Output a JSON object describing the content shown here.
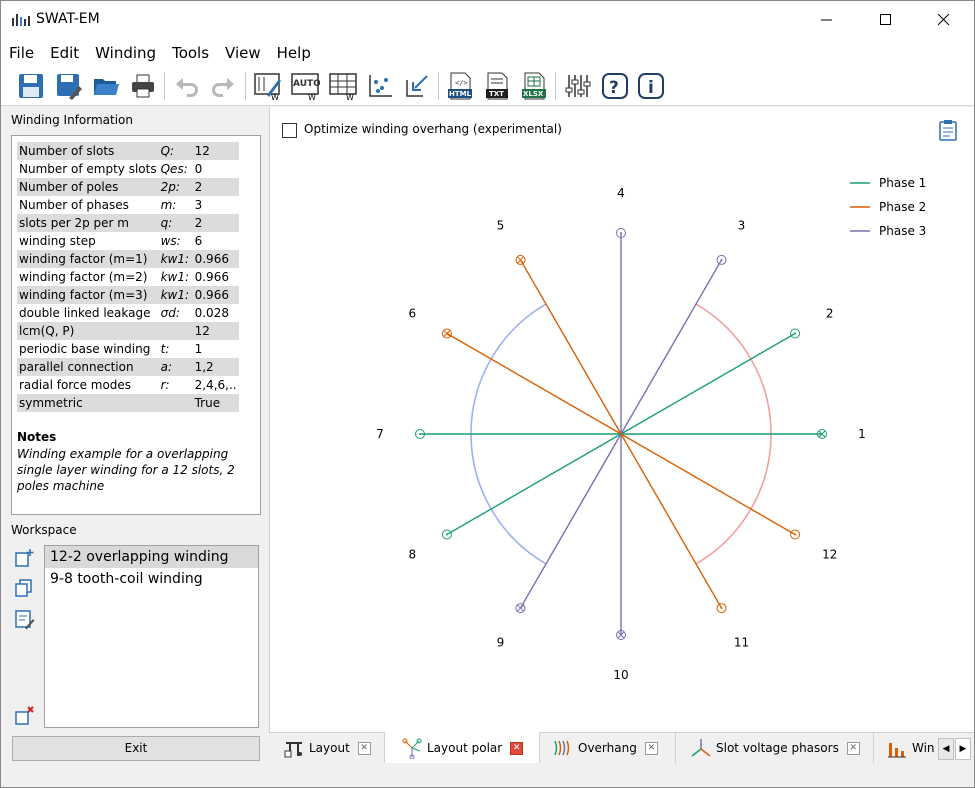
{
  "app": {
    "title": "SWAT-EM"
  },
  "menu": [
    "File",
    "Edit",
    "Winding",
    "Tools",
    "View",
    "Help"
  ],
  "toolbar": {
    "icons": [
      "save-icon",
      "save-as-icon",
      "open-folder-icon",
      "print-icon",
      "undo-icon",
      "redo-icon",
      "winding-editor-icon",
      "auto-winding-icon",
      "table-winding-icon",
      "scatter-plot-icon",
      "import-icon",
      "export-html-icon",
      "export-txt-icon",
      "export-xlsx-icon",
      "settings-sliders-icon",
      "help-icon",
      "info-icon"
    ],
    "labels": {
      "html": "HTML",
      "txt": "TXT",
      "xlsx": "XLSX",
      "auto": "AUTO"
    }
  },
  "winding_info": {
    "label": "Winding Information",
    "rows": [
      [
        "Number of slots",
        "Q:",
        "12"
      ],
      [
        "Number of empty slots",
        "Qes:",
        "0"
      ],
      [
        "Number of poles",
        "2p:",
        "2"
      ],
      [
        "Number of phases",
        "m:",
        "3"
      ],
      [
        "slots per 2p per m",
        "q:",
        "2"
      ],
      [
        "winding step",
        "ws:",
        "6"
      ],
      [
        "winding factor (m=1)",
        "kw1:",
        "0.966"
      ],
      [
        "winding factor (m=2)",
        "kw1:",
        "0.966"
      ],
      [
        "winding factor (m=3)",
        "kw1:",
        "0.966"
      ],
      [
        "double linked leakage",
        "σd:",
        "0.028"
      ],
      [
        "lcm(Q, P)",
        "",
        "12"
      ],
      [
        "periodic base winding",
        "t:",
        "1"
      ],
      [
        "parallel connection",
        "a:",
        "1,2"
      ],
      [
        "radial force modes",
        "r:",
        "2,4,6,.."
      ],
      [
        "symmetric",
        "",
        "True"
      ]
    ],
    "notes_title": "Notes",
    "notes_text": "Winding example for a overlapping single layer winding for a 12 slots, 2 poles machine"
  },
  "workspace": {
    "label": "Workspace",
    "items": [
      "12-2 overlapping winding",
      "9-8 tooth-coil winding"
    ],
    "selected": 0
  },
  "exit_label": "Exit",
  "plot": {
    "checkbox_label": "Optimize winding overhang (experimental)",
    "checked": false
  },
  "chart_data": {
    "type": "polar",
    "slot_labels": [
      "1",
      "2",
      "3",
      "4",
      "5",
      "6",
      "7",
      "8",
      "9",
      "10",
      "11",
      "12"
    ],
    "slots": [
      {
        "slot": 1,
        "angle_deg": 0,
        "phase": "Phase 1",
        "marker": "x"
      },
      {
        "slot": 2,
        "angle_deg": 30,
        "phase": "Phase 1",
        "marker": "o"
      },
      {
        "slot": 3,
        "angle_deg": 60,
        "phase": "Phase 3",
        "marker": "o"
      },
      {
        "slot": 4,
        "angle_deg": 90,
        "phase": "Phase 3",
        "marker": "o"
      },
      {
        "slot": 5,
        "angle_deg": 120,
        "phase": "Phase 2",
        "marker": "x"
      },
      {
        "slot": 6,
        "angle_deg": 150,
        "phase": "Phase 2",
        "marker": "x"
      },
      {
        "slot": 7,
        "angle_deg": 180,
        "phase": "Phase 1",
        "marker": "o"
      },
      {
        "slot": 8,
        "angle_deg": 210,
        "phase": "Phase 1",
        "marker": "o"
      },
      {
        "slot": 9,
        "angle_deg": 240,
        "phase": "Phase 3",
        "marker": "x"
      },
      {
        "slot": 10,
        "angle_deg": 270,
        "phase": "Phase 3",
        "marker": "x"
      },
      {
        "slot": 11,
        "angle_deg": 300,
        "phase": "Phase 2",
        "marker": "o"
      },
      {
        "slot": 12,
        "angle_deg": 330,
        "phase": "Phase 2",
        "marker": "o"
      }
    ],
    "overhang_arcs": [
      {
        "phase": "Phase 1",
        "start_deg": -60,
        "end_deg": 60
      },
      {
        "phase": "Phase 3",
        "start_deg": 120,
        "end_deg": 240
      }
    ],
    "legend": [
      {
        "name": "Phase 1",
        "color": "#1b9e77"
      },
      {
        "name": "Phase 2",
        "color": "#d95f02"
      },
      {
        "name": "Phase 3",
        "color": "#7570b3"
      }
    ],
    "arc_colors": {
      "Phase 1": "#f4a0a0",
      "Phase 3": "#9fb0f0"
    },
    "legend_position": "top-right"
  },
  "tabs": [
    {
      "label": "Layout",
      "icon": "layout-icon",
      "active": false
    },
    {
      "label": "Layout polar",
      "icon": "layout-polar-icon",
      "active": true
    },
    {
      "label": "Overhang",
      "icon": "overhang-icon",
      "active": false
    },
    {
      "label": "Slot voltage phasors",
      "icon": "phasors-icon",
      "active": false
    },
    {
      "label": "Win",
      "icon": "bar-chart-icon",
      "active": false
    }
  ]
}
